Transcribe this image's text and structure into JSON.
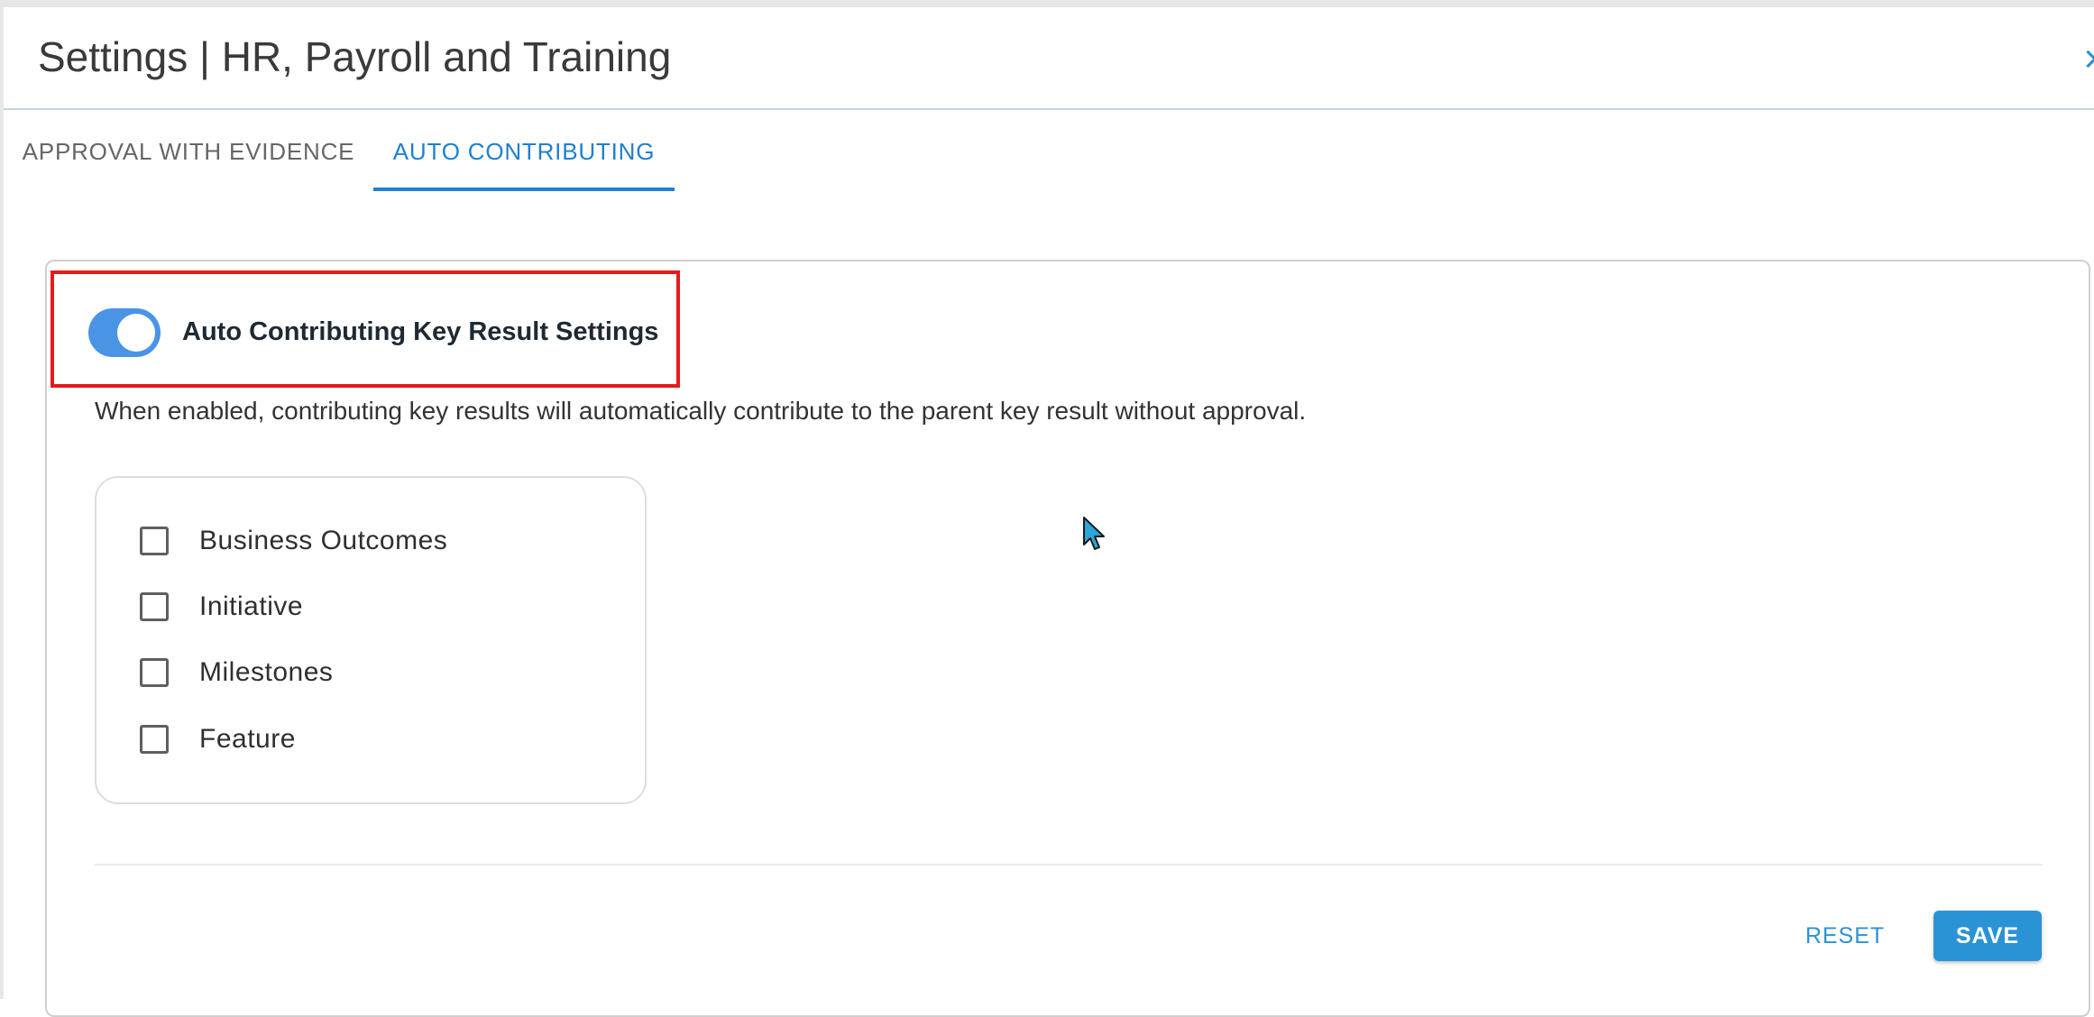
{
  "header": {
    "title": "Settings | HR, Payroll and Training",
    "close_glyph": "×"
  },
  "tabs": [
    {
      "label": "APPROVAL WITH EVIDENCE",
      "active": false
    },
    {
      "label": "AUTO CONTRIBUTING",
      "active": true
    }
  ],
  "setting": {
    "toggle_on": true,
    "label": "Auto Contributing Key Result Settings",
    "description": "When enabled, contributing key results will automatically contribute to the parent key result without approval."
  },
  "options": [
    {
      "label": "Business Outcomes",
      "checked": false
    },
    {
      "label": "Initiative",
      "checked": false
    },
    {
      "label": "Milestones",
      "checked": false
    },
    {
      "label": "Feature",
      "checked": false
    }
  ],
  "actions": {
    "reset_label": "RESET",
    "save_label": "SAVE"
  },
  "colors": {
    "accent": "#1f7fd1",
    "toggle": "#4a94e6",
    "button": "#2a93d5",
    "highlight_border": "#e41b1b"
  },
  "icons": {
    "close": "close-icon",
    "cursor": "mouse-pointer-icon"
  }
}
